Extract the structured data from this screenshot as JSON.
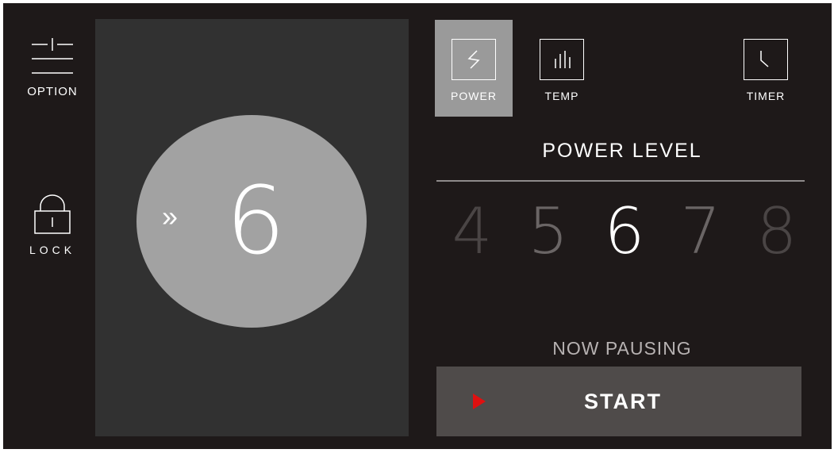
{
  "sidebar": {
    "option": {
      "label": "OPTION",
      "icon": "sliders-icon"
    },
    "lock": {
      "label": "LOCK",
      "icon": "padlock-icon"
    }
  },
  "dial": {
    "chevron": "»",
    "value": "6"
  },
  "tabs": [
    {
      "label": "POWER",
      "icon": "lightning-icon",
      "active": true
    },
    {
      "label": "TEMP",
      "icon": "bars-icon",
      "active": false
    },
    {
      "label": "TIMER",
      "icon": "clock-icon",
      "active": false
    }
  ],
  "power_level": {
    "title": "POWER LEVEL",
    "levels": [
      "4",
      "5",
      "6",
      "7",
      "8"
    ],
    "selected": "6"
  },
  "status": "NOW PAUSING",
  "start_button": {
    "label": "START"
  },
  "colors": {
    "background": "#1e1919",
    "panel": "#313131",
    "dial": "#a2a2a2",
    "active_tab": "#9a9a9a",
    "start_button": "#4f4b4a",
    "play_accent": "#e01010",
    "level_selected": "#ffffff",
    "level_near": "#6a6565",
    "level_far": "#4a4545"
  }
}
